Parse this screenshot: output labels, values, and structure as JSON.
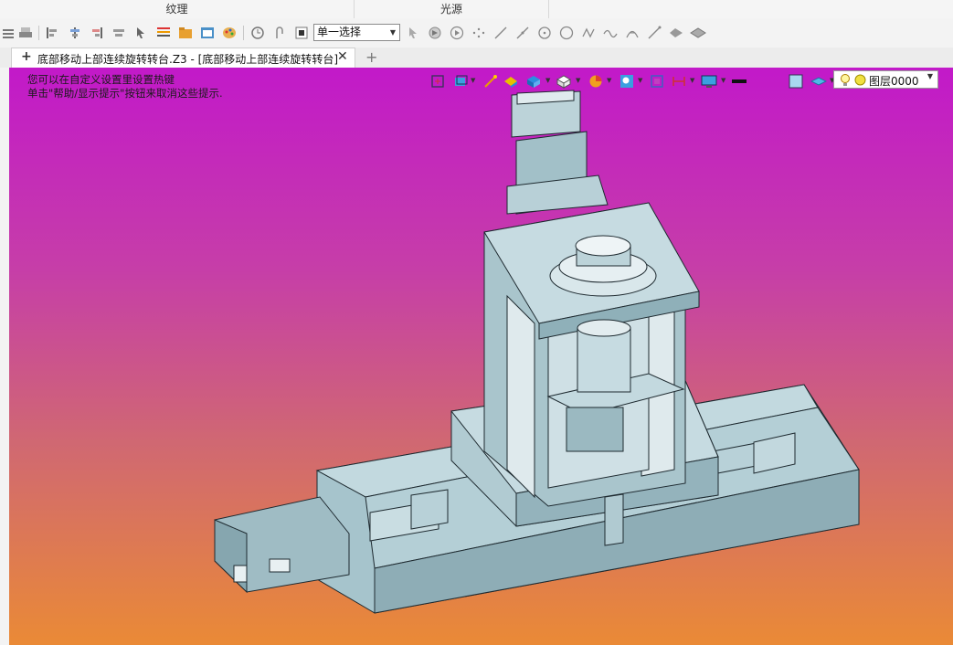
{
  "ribbon": {
    "groups": [
      "纹理",
      "光源"
    ]
  },
  "toolbar": {
    "selection_mode": "单一选择",
    "icons": [
      "stack-icon",
      "print-icon",
      "align-left-icon",
      "align-center-icon",
      "align-right-icon",
      "distribute-icon",
      "cursor-icon",
      "list-icon",
      "folder-icon",
      "calendar-icon",
      "palette-icon",
      "clock-icon",
      "undo-arc-icon",
      "stop-icon",
      "pick-arrow-icon",
      "pick-face-icon",
      "play-icon",
      "dots-icon",
      "line-icon",
      "edge-icon",
      "circle-point-icon",
      "circle-icon",
      "curve-icon",
      "wave-icon",
      "arc-icon",
      "pen-icon",
      "fish-icon",
      "sheet-icon"
    ]
  },
  "tabs": {
    "document_title": "底部移动上部连续旋转转台.Z3 - [底部移动上部连续旋转转台]",
    "new_tab": "+"
  },
  "viewport": {
    "hint_line1": "您可以在自定义设置里设置热键",
    "hint_line2": "单击\"帮助/显示提示\"按钮来取消这些提示.",
    "layer_name": "图层0000",
    "gradient_top": "#c219c9",
    "gradient_bottom": "#ea8a36",
    "model_color": "#a6c4cc"
  }
}
